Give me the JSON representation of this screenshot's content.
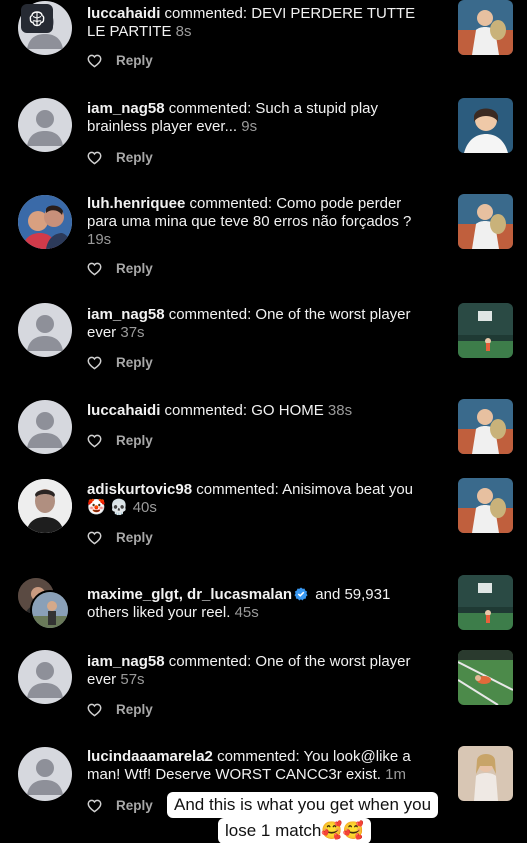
{
  "notifications": [
    {
      "user": "luccahaidi",
      "text": " commented: DEVI PERDERE TUTTE LE PARTITE",
      "time": "8s",
      "reply": "Reply"
    },
    {
      "user": "iam_nag58",
      "text": " commented: Such a stupid play brainless player ever...",
      "time": "9s",
      "reply": "Reply"
    },
    {
      "user": "luh.henriquee",
      "text": " commented: Como pode perder para uma mina que teve 80 erros não forçados ?",
      "time": "19s",
      "reply": "Reply"
    },
    {
      "user": "iam_nag58",
      "text": " commented: One of the worst player ever",
      "time": "37s",
      "reply": "Reply"
    },
    {
      "user": "luccahaidi",
      "text": " commented: GO HOME",
      "time": "38s",
      "reply": "Reply"
    },
    {
      "user": "adiskurtovic98",
      "text": " commented: Anisimova beat you 🤡 💀",
      "time": "40s",
      "reply": "Reply"
    },
    {
      "user": "maxime_glgt, dr_lucasmalan",
      "text": " and 59,931 others liked your reel.",
      "time": "45s"
    },
    {
      "user": "iam_nag58",
      "text": " commented: One of the worst player ever",
      "time": "57s",
      "reply": "Reply"
    },
    {
      "user": "lucindaaamarela2",
      "text": " commented: You look@like a man! Wtf! Deserve WORST CANCC3r exist.",
      "time": "1m",
      "reply": "Reply"
    }
  ],
  "caption": {
    "line1": "And this is what you get when you",
    "line2": "lose 1 match🥰🥰"
  },
  "icons": {
    "brain": "brain-icon",
    "heart": "heart-outline-icon",
    "verified": "verified-badge-icon"
  },
  "colors": {
    "background": "#000000",
    "text": "#f2f2f2",
    "muted": "#9a9a9a",
    "verified": "#3897f0"
  }
}
